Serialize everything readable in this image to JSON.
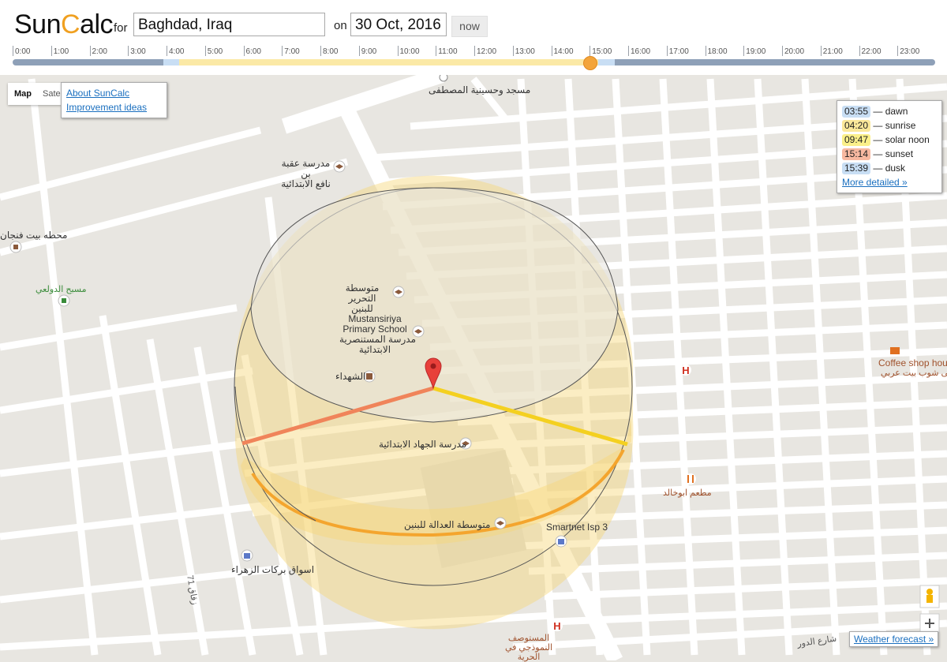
{
  "app": {
    "logo_part1": "Sun",
    "logo_c": "C",
    "logo_part2": "alc",
    "for_label": "for",
    "location_value": "Baghdad, Iraq",
    "on_label": "on",
    "date_value": "30 Oct, 2016",
    "now_label": "now"
  },
  "timeline": {
    "hours": [
      "0:00",
      "1:00",
      "2:00",
      "3:00",
      "4:00",
      "5:00",
      "6:00",
      "7:00",
      "8:00",
      "9:00",
      "10:00",
      "11:00",
      "12:00",
      "13:00",
      "14:00",
      "15:00",
      "16:00",
      "17:00",
      "18:00",
      "19:00",
      "20:00",
      "21:00",
      "22:00",
      "23:00"
    ],
    "dawn_hour": 3.92,
    "sunrise_hour": 4.33,
    "sunset_hour": 15.23,
    "dusk_hour": 15.65,
    "current_hour": 15.0
  },
  "map_controls": {
    "map_label": "Map",
    "satellite_label": "Satel"
  },
  "links": {
    "about": "About SunCalc",
    "ideas": "Improvement ideas"
  },
  "legend": {
    "items": [
      {
        "time": "03:55",
        "label": "— dawn",
        "color": "#c8def4"
      },
      {
        "time": "04:20",
        "label": "— sunrise",
        "color": "#fbe89a"
      },
      {
        "time": "09:47",
        "label": "— solar noon",
        "color": "#fbf08a"
      },
      {
        "time": "15:14",
        "label": "— sunset",
        "color": "#f7b8a0"
      },
      {
        "time": "15:39",
        "label": "— dusk",
        "color": "#c8def4"
      }
    ],
    "more": "More detailed »"
  },
  "weather": "Weather forecast »",
  "places": {
    "mosque": "مسجد وحسينية المصطفى",
    "school1": "مدرسة عقبة بن\nنافع الابتدائية",
    "station": "محطه بيت فنجان",
    "nursery": "مسبح الدولعي",
    "school2": "متوسطة التحرير\nللبنين",
    "school3a": "Mustansiriya",
    "school3b": "Primary School",
    "school3c": "مدرسة المستنصرية",
    "school3d": "الابتدائية",
    "martyrs": "الشهداء",
    "jihad": "مدرسة الجهاد الابتدائية",
    "adala": "متوسطة العدالة للبنين",
    "smartnet": "Smartnet Isp 3",
    "barakat": "اسواق بركات الزهراء",
    "hospital": "المستوصف\nالنموذجي في الحرية",
    "coffee1": "Coffee shop hou",
    "coffee2": "مقهى شوب بيت عربي",
    "restaurant": "مطعم ابوخالد",
    "alley": "زقاق 71",
    "street": "شارع الدور"
  }
}
